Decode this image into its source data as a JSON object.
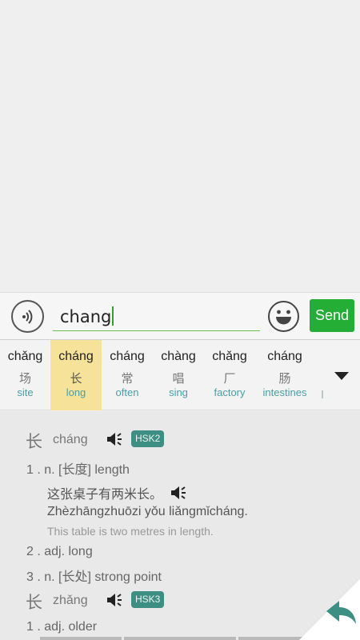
{
  "input_bar": {
    "voice_icon": "voice-input-icon",
    "text_value": "chang",
    "emoji_icon": "smiley-icon",
    "send_label": "Send",
    "send_color": "#24ae35"
  },
  "candidates": [
    {
      "pinyin": "chǎng",
      "hanzi": "场",
      "english": "site"
    },
    {
      "pinyin": "cháng",
      "hanzi": "长",
      "english": "long",
      "selected": true
    },
    {
      "pinyin": "cháng",
      "hanzi": "常",
      "english": "often"
    },
    {
      "pinyin": "chàng",
      "hanzi": "唱",
      "english": "sing"
    },
    {
      "pinyin": "chǎng",
      "hanzi": "厂",
      "english": "factory"
    },
    {
      "pinyin": "cháng",
      "hanzi": "肠",
      "english": "intestines"
    }
  ],
  "candidate_more_icon": "triangle-down-icon",
  "dictionary": {
    "entries": [
      {
        "hanzi": "长",
        "pinyin": "cháng",
        "hsk": "HSK2",
        "definitions": [
          {
            "text": "1 . n. [长度] length"
          },
          {
            "text": "2 . adj. long"
          },
          {
            "text": "3 . n. [长处] strong point"
          }
        ],
        "example": {
          "zh": "这张桌子有两米长。",
          "py": "Zhèzhāngzhuōzi yǒu liǎngmǐcháng.",
          "en": "This table is two metres in length."
        }
      },
      {
        "hanzi": "长",
        "pinyin": "zhǎng",
        "hsk": "HSK3",
        "definitions": [
          {
            "text": "1 . adj. older"
          }
        ]
      }
    ],
    "hsk_color": "#3d8f84"
  },
  "back_icon": "back-arrow-icon"
}
